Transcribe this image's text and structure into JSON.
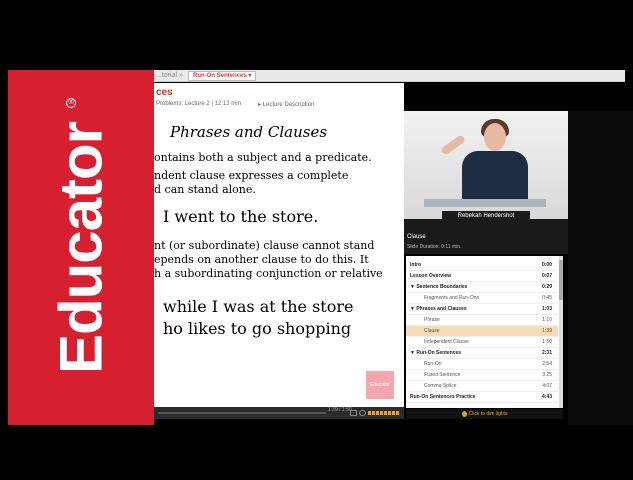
{
  "brand": {
    "name": "Educator",
    "registered": "®",
    "color": "#d7202f"
  },
  "topbar": {
    "crumb": "...torial »",
    "select": "Run-On Sentences ▾"
  },
  "lesson": {
    "title": "ces",
    "meta": "Problems: Lecture 2 | 12:13 min",
    "description": "▸ Lecture Description"
  },
  "slide": {
    "title": "Phrases and Clauses",
    "lines": [
      "ontains both a subject and a predicate.",
      "ndent clause expresses a complete",
      "d can stand alone.",
      "I went to the store.",
      "nt (or subordinate) clause cannot stand",
      "epends on another clause to do this. It",
      "h a subordinating conjunction or relative",
      "while I was at the store",
      "ho likes to go shopping"
    ],
    "logo": "Educator"
  },
  "player": {
    "time": "1:39 / 1:50"
  },
  "video": {
    "instructor": "Rebekah Hendershot",
    "caption_title": "Clause",
    "caption_duration": "Slide Duration: 0:11 min."
  },
  "playlist": {
    "items": [
      {
        "label": "Intro",
        "time": "0:00",
        "kind": "section"
      },
      {
        "label": "Lesson Overview",
        "time": "0:07",
        "kind": "section"
      },
      {
        "label": "▼ Sentence Boundaries",
        "time": "0:29",
        "kind": "section"
      },
      {
        "label": "Fragments and Run-Ons",
        "time": "0:45",
        "kind": "sub"
      },
      {
        "label": "▼ Phrases and Clauses",
        "time": "1:03",
        "kind": "section"
      },
      {
        "label": "Phrase",
        "time": "1:10",
        "kind": "sub"
      },
      {
        "label": "Clause",
        "time": "1:39",
        "kind": "sub",
        "active": true
      },
      {
        "label": "Independent Clause",
        "time": "1:50",
        "kind": "sub"
      },
      {
        "label": "▼ Run-On Sentences",
        "time": "2:31",
        "kind": "section"
      },
      {
        "label": "Run-On",
        "time": "2:54",
        "kind": "sub"
      },
      {
        "label": "Fused Sentence",
        "time": "3:25",
        "kind": "sub"
      },
      {
        "label": "Comma Splice",
        "time": "4:07",
        "kind": "sub"
      },
      {
        "label": "Run-On Sentences Practice",
        "time": "4:43",
        "kind": "section"
      }
    ]
  },
  "dimlights": "Click to dim lights",
  "colors": {
    "accent": "#e0a02a",
    "highlight": "#f7ddb6",
    "title_red": "#c03a2b"
  }
}
